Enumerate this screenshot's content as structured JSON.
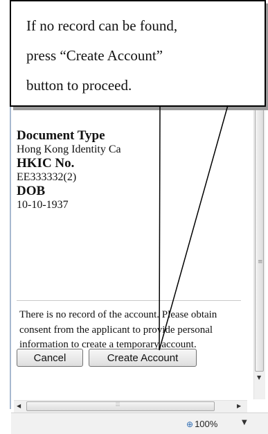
{
  "callout": {
    "lines": [
      "If no record can be found,",
      "press “Create Account”",
      "button to proceed."
    ]
  },
  "record": {
    "document_type_label": "Document Type",
    "document_type_value": "Hong Kong Identity Ca",
    "hkic_label": "HKIC No.",
    "hkic_value": "EE333332(2)",
    "dob_label": "DOB",
    "dob_value": "10-10-1937"
  },
  "message": "There is no record of the account. Please obtain consent from the applicant to provide personal information to create a temporary account.",
  "buttons": {
    "cancel_label": "Cancel",
    "create_account_label": "Create Account"
  },
  "statusbar": {
    "zoom_label": "100%"
  },
  "icons": {
    "zoom": "zoom-icon",
    "dropdown": "chevron-down-icon"
  }
}
